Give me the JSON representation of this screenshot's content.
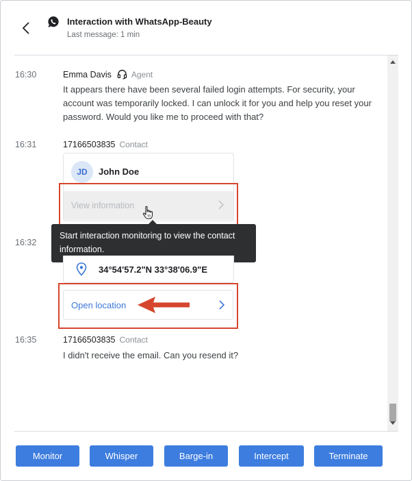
{
  "header": {
    "title": "Interaction with WhatsApp-Beauty",
    "subtitle": "Last message: 1 min",
    "back_icon": "chevron-left-icon",
    "channel_icon": "whatsapp-icon"
  },
  "messages": [
    {
      "time": "16:30",
      "sender": "Emma Davis",
      "role": "Agent",
      "text": "It appears there have been several failed login attempts. For security, your account was temporarily locked. I can unlock it for you and help you reset your password. Would you like me to proceed with that?"
    },
    {
      "time": "16:31",
      "sender": "17166503835",
      "role": "Contact",
      "contact_card": {
        "initials": "JD",
        "name": "John Doe",
        "action_label": "View information"
      }
    },
    {
      "time": "16:32",
      "location_card": {
        "coords": "34°54'57.2\"N 33°38'06.9\"E",
        "action_label": "Open location"
      }
    },
    {
      "time": "16:35",
      "sender": "17166503835",
      "role": "Contact",
      "text": "I didn't receive the email. Can you resend it?"
    }
  ],
  "tooltip": {
    "text": "Start interaction monitoring to view the contact information."
  },
  "footer": {
    "buttons": [
      {
        "label": "Monitor"
      },
      {
        "label": "Whisper"
      },
      {
        "label": "Barge-in"
      },
      {
        "label": "Intercept"
      },
      {
        "label": "Terminate"
      }
    ]
  },
  "colors": {
    "primary": "#3d7ddf",
    "link": "#3b78d8",
    "highlight": "#d6452d",
    "tooltip_bg": "#2e2f31"
  }
}
